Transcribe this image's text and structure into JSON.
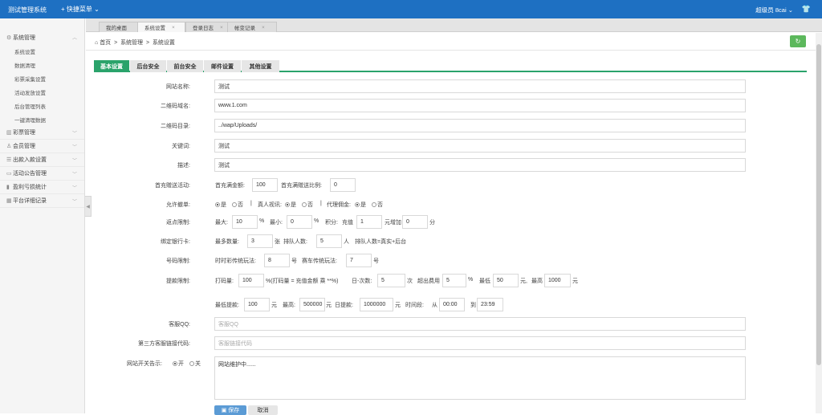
{
  "app": {
    "title": "测试管理系统",
    "quick_menu": "快捷菜单",
    "user": "超级员",
    "user_name": "8cai"
  },
  "sidebar": [
    {
      "label": "系统管理",
      "icon": "gear-icon",
      "open": true
    },
    {
      "label": "彩票管理",
      "icon": "chart-icon"
    },
    {
      "label": "会员管理",
      "icon": "user-icon"
    },
    {
      "label": "出款入款设置",
      "icon": "list-icon"
    },
    {
      "label": "活动公告管理",
      "icon": "board-icon"
    },
    {
      "label": "盈利亏损统计",
      "icon": "bar-icon"
    },
    {
      "label": "平台详细记录",
      "icon": "table-icon"
    }
  ],
  "sidebar_sub": [
    "系统设置",
    "数据清理",
    "彩票采集设置",
    "活动发放设置",
    "后台管理列表",
    "一键清理数据"
  ],
  "tabs": [
    {
      "label": "我的桌面",
      "closable": false
    },
    {
      "label": "系统设置",
      "closable": true,
      "active": true
    },
    {
      "label": "登录日志",
      "closable": true
    },
    {
      "label": "帐变记录",
      "closable": true
    }
  ],
  "breadcrumb": {
    "home": "首页",
    "sep": ">",
    "a": "系统管理",
    "b": "系统设置"
  },
  "form_tabs": [
    "基本设置",
    "后台安全",
    "前台安全",
    "邮件设置",
    "其他设置"
  ],
  "fields": {
    "site_name_label": "网站名称:",
    "site_name": "测试",
    "qr_domain_label": "二维码域名:",
    "qr_domain": "www.1.com",
    "qr_dir_label": "二维码目录:",
    "qr_dir": "../wap/Uploads/",
    "keywords_label": "关键词:",
    "keywords": "测试",
    "desc_label": "描述:",
    "desc": "测试",
    "first_recharge_label": "首充赠送活动:",
    "first_amount_label": "首充满金额:",
    "first_amount": "100",
    "first_ratio_label": "首充满赠送比例:",
    "first_ratio": "0",
    "allow_cancel_label": "允许撤单:",
    "yes": "是",
    "no": "否",
    "sep": "|",
    "real_video": "真人视讯:",
    "agent_comm": "代理佣金:",
    "rebate_label": "返点限制:",
    "max": "最大:",
    "max_val": "10",
    "pct": "%",
    "min": "最小:",
    "min_val": "0",
    "points": "积分:",
    "recharge": "充值",
    "recharge_val": "1",
    "yuan_add": "元增加",
    "add_val": "0",
    "fen": "分",
    "bank_label": "绑定银行卡:",
    "max_count": "最多数量:",
    "max_count_val": "3",
    "zhang": "张",
    "queue_label": "排队人数:",
    "queue_val": "5",
    "ren": "人",
    "queue_note": "排队人数=真实+后台",
    "number_label": "号码限制:",
    "ssc_label": "时时彩传统玩法:",
    "ssc_val": "8",
    "hao": "号",
    "pk_label": "赛车传统玩法:",
    "pk_val": "7",
    "withdraw_label": "提款限制:",
    "bet_label": "打码量:",
    "bet_val": "100",
    "bet_note": "%(打码量 = 充值金额 乘 **%)",
    "daily_label": "日-次数:",
    "daily_val": "5",
    "ci": "次",
    "over_fee": "超出费用",
    "over_fee_val": "5",
    "min_fee": "最低",
    "min_fee_val": "50",
    "yuan_c": "元,",
    "max_fee": "最高",
    "max_fee_val": "1000",
    "yuan": "元",
    "min_withdraw": "最低提款:",
    "min_withdraw_val": "100",
    "max_w": "最高:",
    "max_w_val": "500000",
    "daily_w": "日提款:",
    "daily_w_val": "1000000",
    "time_range": "时间段:",
    "from": "从",
    "from_val": "00:00",
    "to": "到",
    "to_val": "23:59",
    "qq_label": "客服QQ:",
    "qq_ph": "客服QQ",
    "third_label": "第三方客服链接代码:",
    "third_ph": "客服链接代码",
    "site_switch_label": "网站开关告示:",
    "on": "开",
    "off": "关",
    "notice": "网站维护中......"
  },
  "buttons": {
    "save": "保存",
    "cancel": "取消"
  },
  "colors": {
    "topbar": "#1e70c2",
    "accent": "#2aa36b",
    "refresh": "#5cb85c"
  }
}
